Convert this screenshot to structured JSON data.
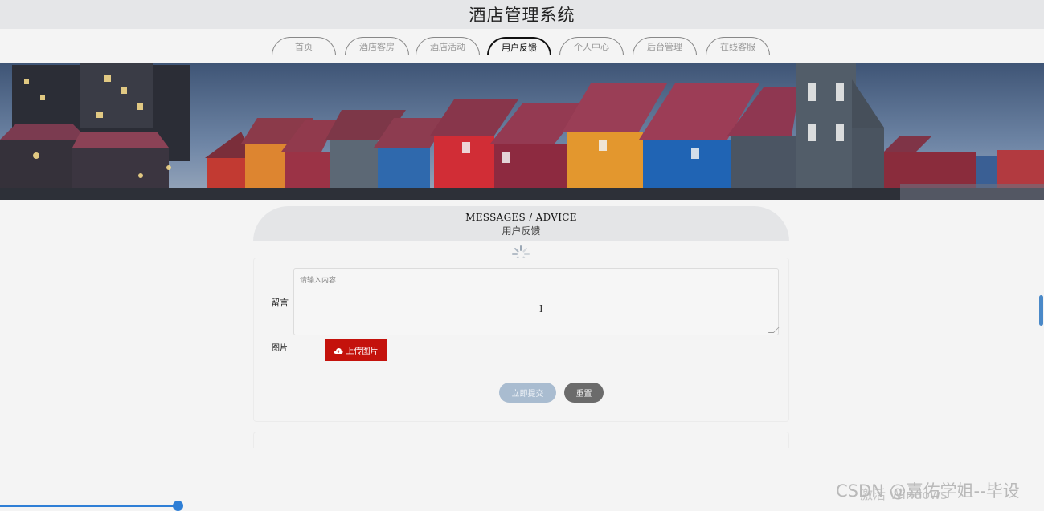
{
  "site": {
    "title": "酒店管理系统"
  },
  "nav": {
    "tabs": [
      {
        "label": "首页"
      },
      {
        "label": "酒店客房"
      },
      {
        "label": "酒店活动"
      },
      {
        "label": "用户反馈",
        "active": true
      },
      {
        "label": "个人中心"
      },
      {
        "label": "后台管理"
      },
      {
        "label": "在线客服"
      }
    ]
  },
  "section": {
    "title_en": "MESSAGES / ADVICE",
    "title_cn": "用户反馈"
  },
  "form": {
    "message_label": "留言",
    "message_placeholder": "请输入内容",
    "image_label": "图片",
    "upload_label": "上传图片",
    "submit_label": "立即提交",
    "reset_label": "重置"
  },
  "overlay": {
    "activate_text": "激活 Windows",
    "watermark": "CSDN @嘉佑学姐--毕设"
  },
  "colors": {
    "upload_button": "#c4120c",
    "submit_button": "#a9bcd0",
    "reset_button": "#6b6b6b",
    "header_bg": "#e5e6e8"
  },
  "icons": {
    "upload": "cloud-upload-icon",
    "loading": "spinner-icon"
  }
}
